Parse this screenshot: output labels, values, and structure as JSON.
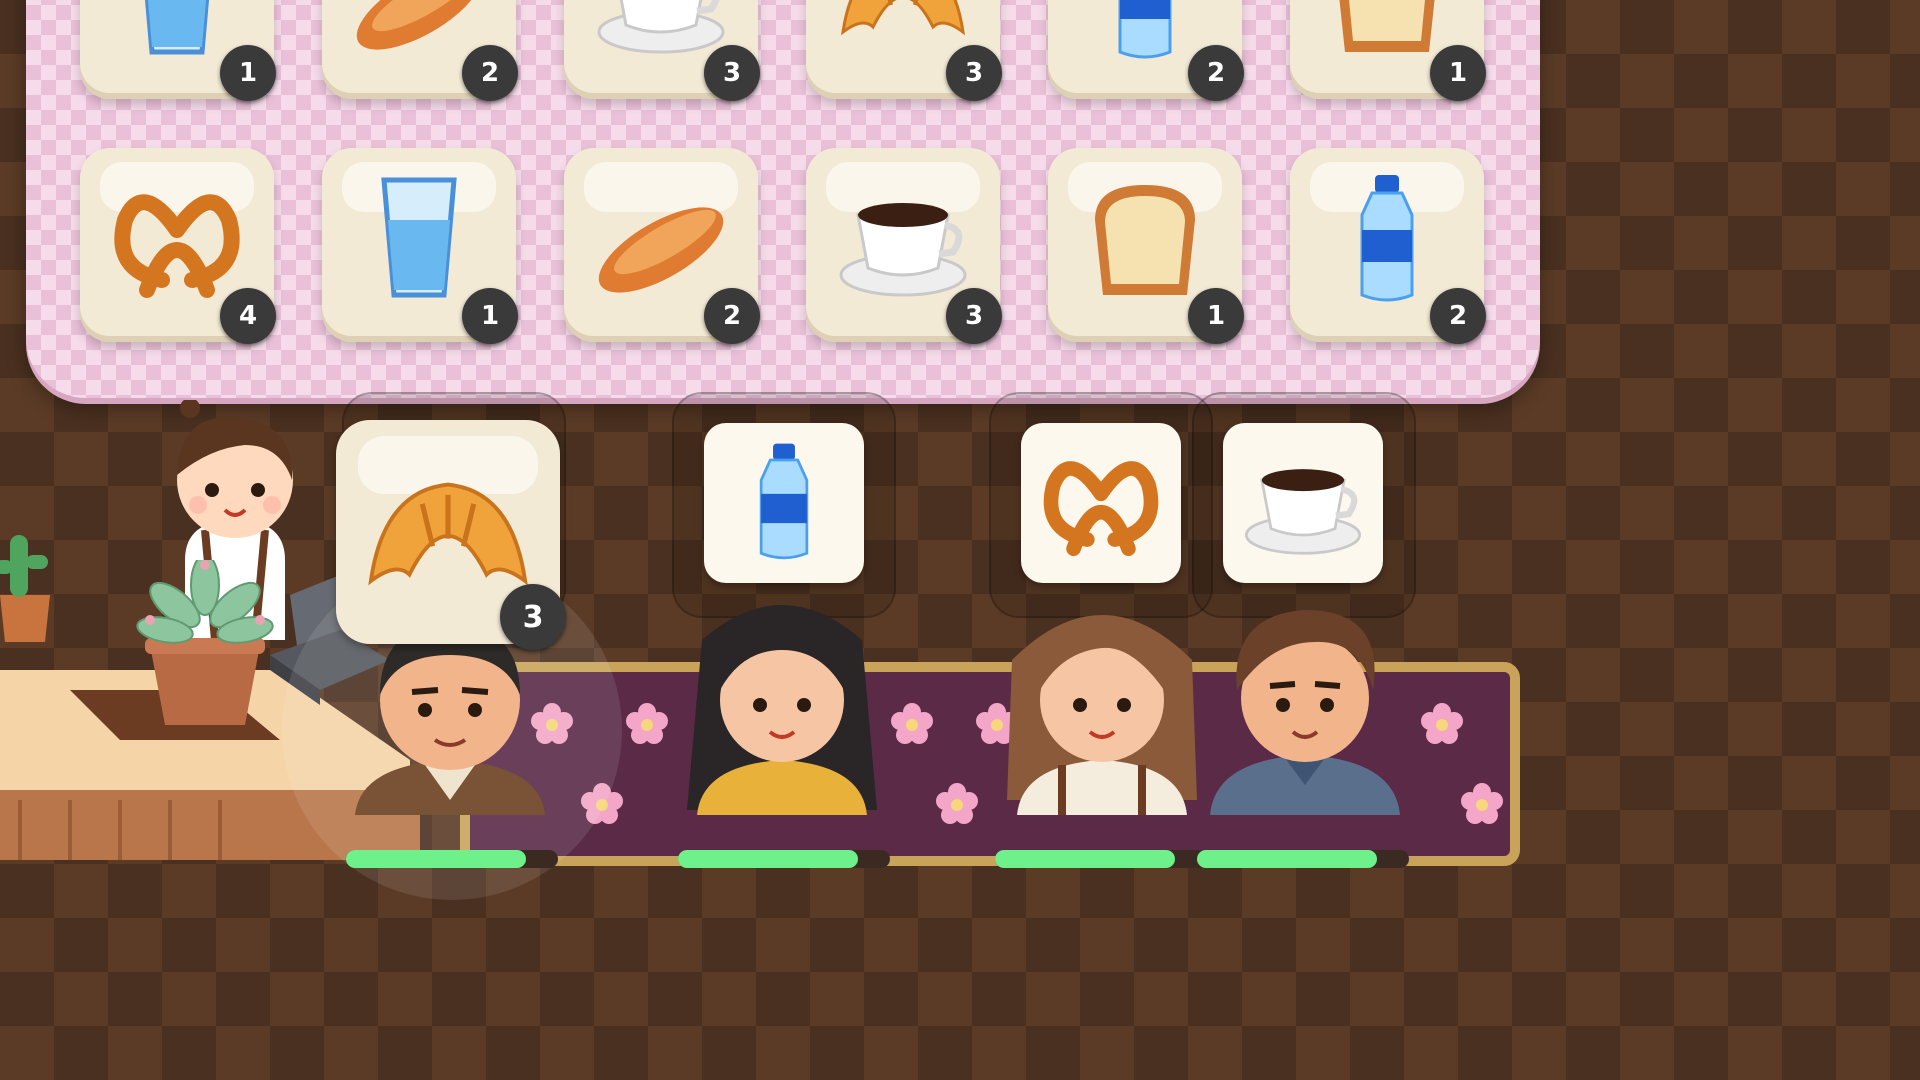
{
  "board": {
    "rows": [
      [
        {
          "item": "water-glass",
          "count": "1"
        },
        {
          "item": "baguette",
          "count": "2"
        },
        {
          "item": "coffee-cup",
          "count": "3"
        },
        {
          "item": "croissant",
          "count": "3"
        },
        {
          "item": "water-bottle",
          "count": "2"
        },
        {
          "item": "toast",
          "count": "1"
        }
      ],
      [
        {
          "item": "pretzel",
          "count": "4"
        },
        {
          "item": "water-glass",
          "count": "1"
        },
        {
          "item": "baguette",
          "count": "2"
        },
        {
          "item": "coffee-cup",
          "count": "3"
        },
        {
          "item": "toast",
          "count": "1"
        },
        {
          "item": "water-bottle",
          "count": "2"
        }
      ]
    ]
  },
  "orders": [
    {
      "customer": "customer-man-brown-jacket",
      "item": "croissant",
      "count": "3",
      "patience": 0.85,
      "active": true
    },
    {
      "customer": "customer-woman-black-hair",
      "item": "water-bottle",
      "patience": 0.85
    },
    {
      "customer": "customer-woman-brown-hair",
      "item": "pretzel",
      "patience": 0.85
    },
    {
      "customer": "customer-man-blue-shirt",
      "item": "coffee-cup",
      "patience": 0.85
    }
  ],
  "colors": {
    "patience_bar": "#6ef08a",
    "badge": "#3a3a3a",
    "rug": "#5a2a47"
  }
}
